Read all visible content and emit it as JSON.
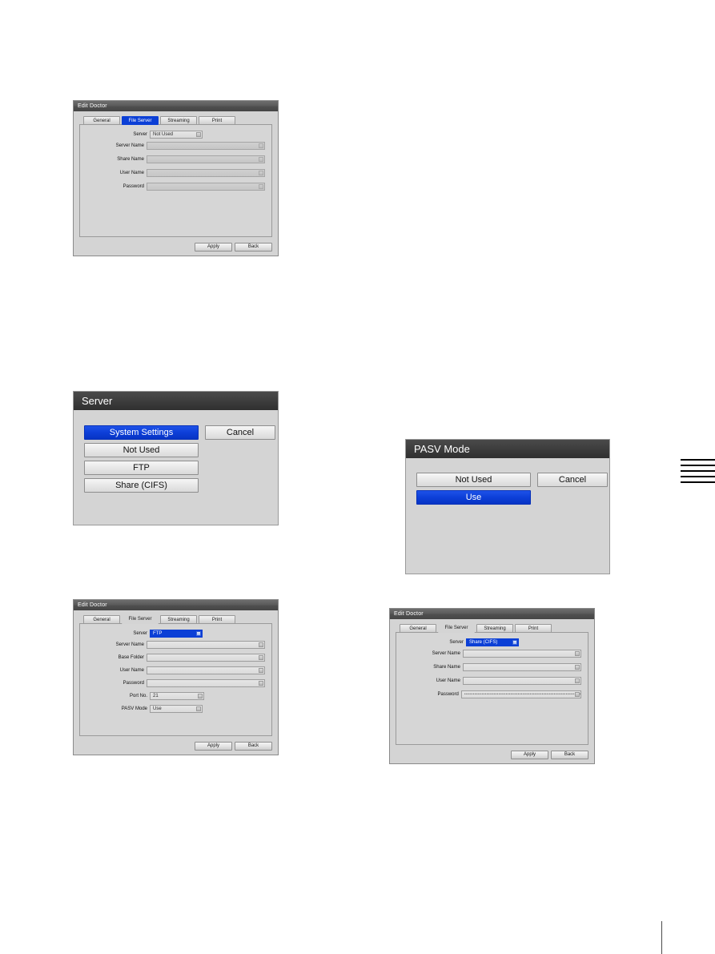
{
  "page": {
    "background": "#ffffff",
    "accent_blue": "#0d3fd8",
    "titlebar_color": "#4a4a4a"
  },
  "dialog_not_used": {
    "title": "Edit Doctor",
    "tabs": [
      {
        "label": "General",
        "state": "normal"
      },
      {
        "label": "File Server",
        "state": "selected"
      },
      {
        "label": "Streaming",
        "state": "normal"
      },
      {
        "label": "Print",
        "state": "normal"
      }
    ],
    "fields": [
      {
        "label": "Server",
        "value": "Not Used",
        "type": "combo",
        "state": "enabled"
      },
      {
        "label": "Server Name",
        "value": "",
        "type": "text",
        "state": "disabled"
      },
      {
        "label": "Share Name",
        "value": "",
        "type": "text",
        "state": "disabled"
      },
      {
        "label": "User Name",
        "value": "",
        "type": "text",
        "state": "disabled"
      },
      {
        "label": "Password",
        "value": "",
        "type": "password",
        "state": "disabled"
      }
    ],
    "buttons": {
      "apply": "Apply",
      "back": "Back"
    }
  },
  "dialog_server_choice": {
    "title": "Server",
    "options": [
      {
        "label": "System Settings",
        "selected": true
      },
      {
        "label": "Not Used",
        "selected": false
      },
      {
        "label": "FTP",
        "selected": false
      },
      {
        "label": "Share (CIFS)",
        "selected": false
      }
    ],
    "cancel": "Cancel"
  },
  "dialog_pasv_choice": {
    "title": "PASV Mode",
    "options": [
      {
        "label": "Not Used",
        "selected": false
      },
      {
        "label": "Use",
        "selected": true
      }
    ],
    "cancel": "Cancel"
  },
  "dialog_ftp": {
    "title": "Edit Doctor",
    "tabs": [
      {
        "label": "General",
        "state": "normal"
      },
      {
        "label": "File Server",
        "state": "active"
      },
      {
        "label": "Streaming",
        "state": "normal"
      },
      {
        "label": "Print",
        "state": "normal"
      }
    ],
    "fields": [
      {
        "label": "Server",
        "value": "FTP",
        "type": "combo",
        "state": "selected"
      },
      {
        "label": "Server Name",
        "value": "",
        "type": "text",
        "state": "enabled"
      },
      {
        "label": "Base Folder",
        "value": "",
        "type": "text",
        "state": "enabled"
      },
      {
        "label": "User Name",
        "value": "",
        "type": "text",
        "state": "enabled"
      },
      {
        "label": "Password",
        "value": "",
        "type": "password",
        "state": "enabled"
      },
      {
        "label": "Port No.",
        "value": "21",
        "type": "text",
        "state": "enabled"
      },
      {
        "label": "PASV Mode",
        "value": "Use",
        "type": "combo",
        "state": "enabled"
      }
    ],
    "buttons": {
      "apply": "Apply",
      "back": "Back"
    }
  },
  "dialog_cifs": {
    "title": "Edit Doctor",
    "tabs": [
      {
        "label": "General",
        "state": "normal"
      },
      {
        "label": "File Server",
        "state": "active"
      },
      {
        "label": "Streaming",
        "state": "normal"
      },
      {
        "label": "Print",
        "state": "normal"
      }
    ],
    "fields": [
      {
        "label": "Server",
        "value": "Share (CIFS)",
        "type": "combo",
        "state": "selected"
      },
      {
        "label": "Server Name",
        "value": "",
        "type": "text",
        "state": "enabled"
      },
      {
        "label": "Share Name",
        "value": "",
        "type": "text",
        "state": "enabled"
      },
      {
        "label": "User Name",
        "value": "",
        "type": "text",
        "state": "enabled"
      },
      {
        "label": "Password",
        "value": "••••••••••••••••••••••••••••••••••••••••••••••••••••••••••••••••••••••• ...",
        "type": "password",
        "state": "filled"
      }
    ],
    "buttons": {
      "apply": "Apply",
      "back": "Back"
    }
  }
}
